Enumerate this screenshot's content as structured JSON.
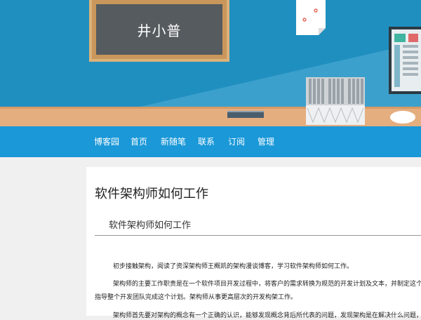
{
  "blackboard": {
    "text": "井小普"
  },
  "nav": {
    "items": [
      "博客园",
      "首页",
      "新随笔",
      "联系",
      "订阅",
      "管理"
    ]
  },
  "article": {
    "title": "软件架构师如何工作",
    "subtitle": "软件架构师如何工作",
    "paragraphs": [
      "初步接触架构，阅读了资深架构师王概凯的架构漫谈博客，学习软件架构师如何工作。",
      "架构师的主要工作职责是在一个软件项目开发过程中，将客户的需求转换为规范的开发计划及文本，并制定这个项目的",
      "指导整个开发团队完成这个计划。架构师从事更高层次的开发构架工作。",
      "架构师首先要对架构的概念有一个正确的认识，能够发现概念背后所代表的问题，发现架构是在解决什么问题，什么是"
    ]
  },
  "colors": {
    "banner": "#1f8fc0",
    "nav": "#1a98d8",
    "desk": "#e5ae7f",
    "blackboard": "#555b5f"
  }
}
